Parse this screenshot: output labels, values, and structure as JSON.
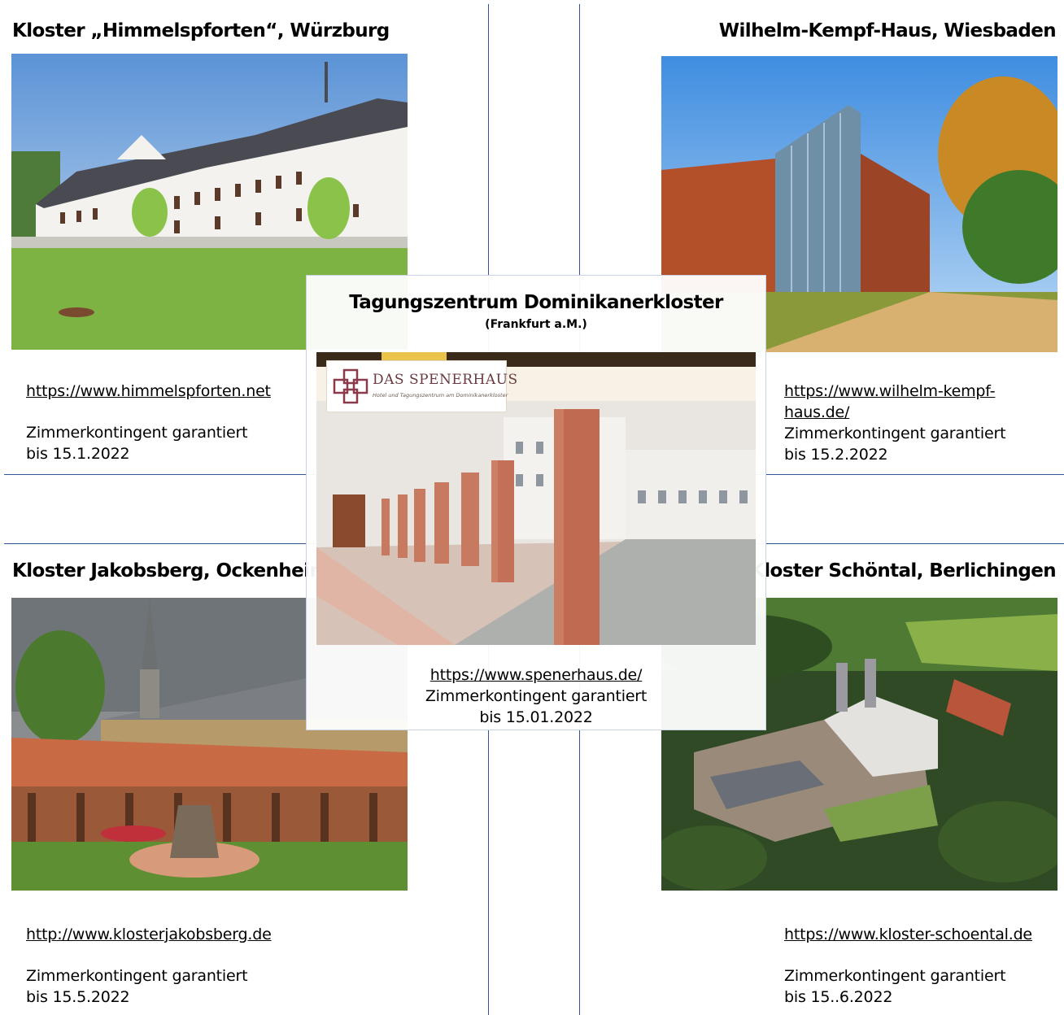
{
  "venues": {
    "himmelspforten": {
      "name": "Kloster „Himmelspforten“, Würzburg",
      "url": "https://www.himmelspforten.net",
      "note_line1": "Zimmerkontingent garantiert",
      "note_line2": "bis 15.1.2022"
    },
    "kempf": {
      "name": "Wilhelm-Kempf-Haus, Wiesbaden",
      "url_line1": "https://www.wilhelm-kempf-",
      "url_line2": "haus.de/",
      "note_line1": "Zimmerkontingent garantiert",
      "note_line2": "bis 15.2.2022"
    },
    "jakobsberg": {
      "name": "Kloster Jakobsberg, Ockenheim",
      "url": "http://www.klosterjakobsberg.de",
      "note_line1": "Zimmerkontingent garantiert",
      "note_line2": "bis 15.5.2022"
    },
    "schoental": {
      "name": "Kloster Schöntal, Berlichingen",
      "url": "https://www.kloster-schoental.de",
      "note_line1": "Zimmerkontingent garantiert",
      "note_line2": "bis 15..6.2022"
    },
    "dominikaner": {
      "name": "Tagungszentrum Dominikanerkloster",
      "subtitle": "(Frankfurt a.M.)",
      "logo_text": "DAS SPENERHAUS",
      "logo_subtext": "Hotel und Tagungszentrum am Dominikanerkloster",
      "url": "https://www.spenerhaus.de/",
      "note_line1": "Zimmerkontingent garantiert",
      "note_line2": "bis 15.01.2022"
    }
  },
  "colors": {
    "card_border": "#2f5597",
    "link": "#000000"
  }
}
